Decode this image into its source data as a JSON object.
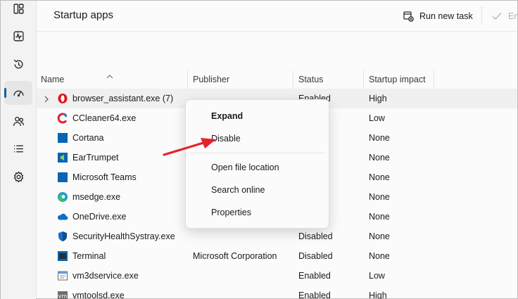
{
  "page_title": "Startup apps",
  "commands": {
    "run_new_task": "Run new task",
    "enable": "Ena"
  },
  "columns": {
    "name": "Name",
    "publisher": "Publisher",
    "status": "Status",
    "impact": "Startup impact"
  },
  "sidebar": {
    "items": [
      {
        "icon": "processes-icon"
      },
      {
        "icon": "performance-icon"
      },
      {
        "icon": "app-history-icon"
      },
      {
        "icon": "startup-apps-icon",
        "active": true
      },
      {
        "icon": "users-icon"
      },
      {
        "icon": "details-icon"
      },
      {
        "icon": "services-icon"
      }
    ]
  },
  "rows": [
    {
      "name": "browser_assistant.exe (7)",
      "publisher": "",
      "status": "Enabled",
      "impact": "High",
      "icon": "opera-icon",
      "expandable": true
    },
    {
      "name": "CCleaner64.exe",
      "publisher": "",
      "status": "",
      "impact": "Low",
      "icon": "ccleaner-icon"
    },
    {
      "name": "Cortana",
      "publisher": "",
      "status": "",
      "impact": "None",
      "icon": "cortana-icon"
    },
    {
      "name": "EarTrumpet",
      "publisher": "",
      "status": "",
      "impact": "None",
      "icon": "eartrumpet-icon"
    },
    {
      "name": "Microsoft Teams",
      "publisher": "",
      "status": "",
      "impact": "None",
      "icon": "teams-icon"
    },
    {
      "name": "msedge.exe",
      "publisher": "",
      "status": "",
      "impact": "None",
      "icon": "edge-icon"
    },
    {
      "name": "OneDrive.exe",
      "publisher": "",
      "status": "",
      "impact": "None",
      "icon": "onedrive-icon"
    },
    {
      "name": "SecurityHealthSystray.exe",
      "publisher": "",
      "status": "Disabled",
      "impact": "None",
      "icon": "shield-icon"
    },
    {
      "name": "Terminal",
      "publisher": "Microsoft Corporation",
      "status": "Disabled",
      "impact": "None",
      "icon": "terminal-icon"
    },
    {
      "name": "vm3dservice.exe",
      "publisher": "",
      "status": "Enabled",
      "impact": "Low",
      "icon": "service-icon"
    },
    {
      "name": "vmtoolsd.exe",
      "publisher": "",
      "status": "Enabled",
      "impact": "High",
      "icon": "vmware-icon"
    }
  ],
  "context_menu": {
    "expand": "Expand",
    "disable": "Disable",
    "open_file_location": "Open file location",
    "search_online": "Search online",
    "properties": "Properties"
  },
  "colors": {
    "accent": "#0f5ea8",
    "annotation_arrow": "#e8222a"
  }
}
